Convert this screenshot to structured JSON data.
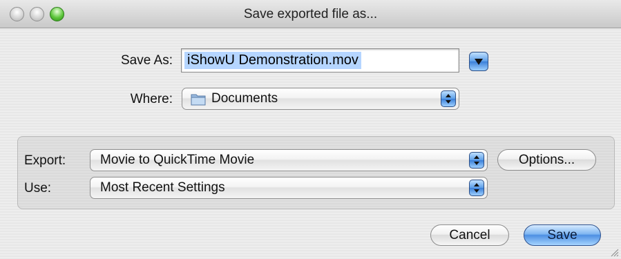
{
  "window": {
    "title": "Save exported file as..."
  },
  "save_as": {
    "label": "Save As:",
    "value": "iShowU Demonstration.mov"
  },
  "where": {
    "label": "Where:",
    "value": "Documents",
    "icon": "folder-icon"
  },
  "export": {
    "label": "Export:",
    "value": "Movie to QuickTime Movie",
    "options_label": "Options..."
  },
  "use": {
    "label": "Use:",
    "value": "Most Recent Settings"
  },
  "buttons": {
    "cancel": "Cancel",
    "save": "Save"
  },
  "colors": {
    "accent": "#4d8fe2",
    "selection": "#b5d5ff"
  }
}
